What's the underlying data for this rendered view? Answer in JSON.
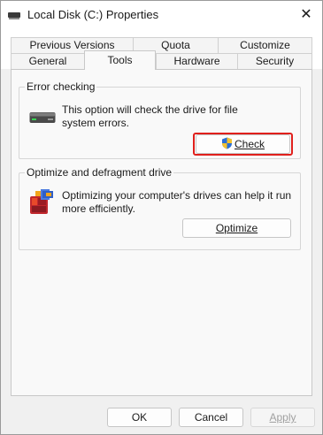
{
  "window": {
    "title": "Local Disk (C:) Properties",
    "icon": "drive-icon",
    "close_glyph": "✕"
  },
  "tabs": {
    "row1": [
      "Previous Versions",
      "Quota",
      "Customize"
    ],
    "row2": [
      "General",
      "Tools",
      "Hardware",
      "Security"
    ],
    "active": "Tools"
  },
  "error_checking": {
    "title": "Error checking",
    "icon": "hard-drive-icon",
    "description_line1": "This option will check the drive for file",
    "description_line2": "system errors.",
    "check_button": "Check",
    "check_icon": "uac-shield-icon",
    "highlight_color": "#e0201c"
  },
  "optimize": {
    "title": "Optimize and defragment drive",
    "icon": "defrag-icon",
    "description_line1": "Optimizing your computer's drives can help it run",
    "description_line2": "more efficiently.",
    "optimize_button": "Optimize"
  },
  "footer": {
    "ok": "OK",
    "cancel": "Cancel",
    "apply": "Apply",
    "apply_enabled": false
  }
}
